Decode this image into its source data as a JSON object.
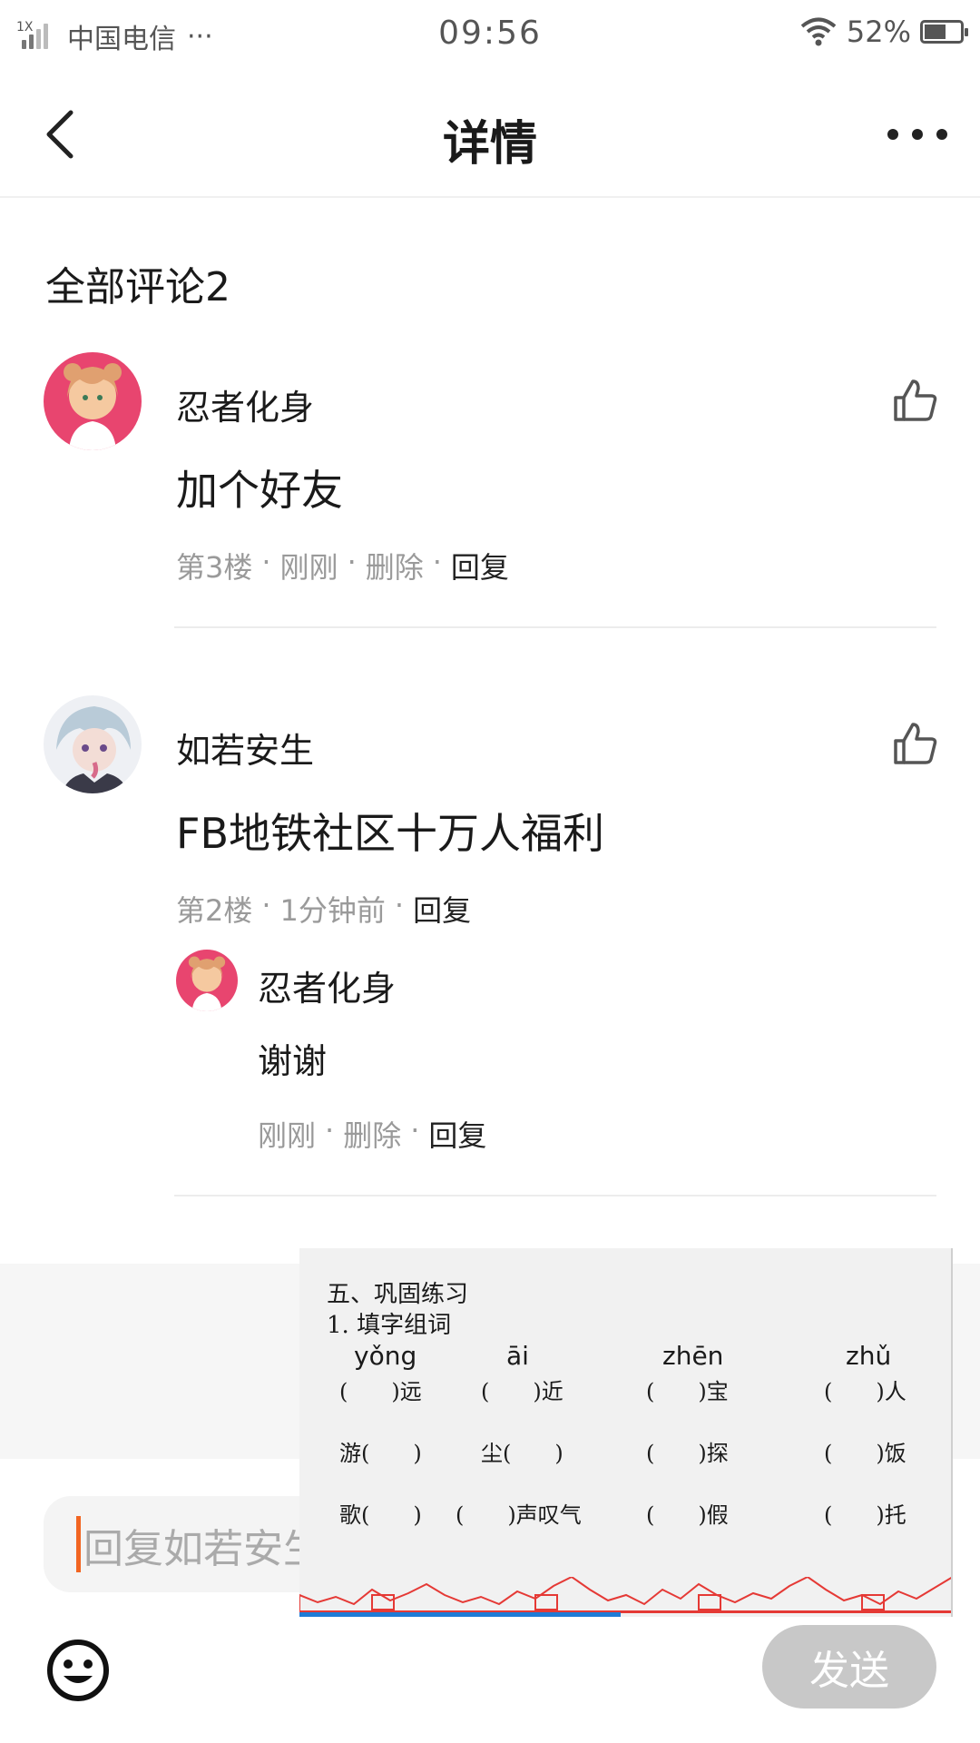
{
  "status_bar": {
    "network_type": "1X",
    "carrier": "中国电信",
    "carrier_more": "···",
    "time": "09:56",
    "battery": "52%",
    "icons": [
      "signal-icon",
      "wifi-icon",
      "battery-charging-icon"
    ]
  },
  "navbar": {
    "back_icon": "chevron-left-icon",
    "title": "详情",
    "more_icon": "more-dots-icon"
  },
  "comments_section": {
    "title": "全部评论2"
  },
  "comments": [
    {
      "name": "忍者化身",
      "text": "加个好友",
      "floor": "第3楼",
      "time": "刚刚",
      "delete": "删除",
      "reply": "回复"
    },
    {
      "name": "如若安生",
      "text": "FB地铁社区十万人福利",
      "floor": "第2楼",
      "time": "1分钟前",
      "reply": "回复",
      "sub_reply": {
        "name": "忍者化身",
        "text": "谢谢",
        "time": "刚刚",
        "delete": "删除",
        "reply": "回复"
      }
    }
  ],
  "input": {
    "placeholder": "回复如若安生"
  },
  "emoji_icon": "smiley-icon",
  "send_label": "发送",
  "overlay_worksheet": {
    "title": "五、巩固练习",
    "subtitle": "1. 填字组词",
    "pinyin": [
      "yǒng",
      "āi",
      "zhēn",
      "zhǔ"
    ],
    "row1": [
      "(　　)远",
      "(　　)近",
      "(　　)宝",
      "(　　)人"
    ],
    "row2": [
      "游(　　)",
      "尘(　　)",
      "(　　)探",
      "(　　)饭"
    ],
    "row3": [
      "歌(　　)",
      "(　　)声叹气",
      "(　　)假",
      "(　　)托"
    ]
  },
  "colors": {
    "accent_caret": "#f26522",
    "send_disabled": "#c8c8c8",
    "avatar1_bg": "#e8456f",
    "overlay_deco": "#e53935",
    "overlay_bar": "#1e7bd6"
  }
}
